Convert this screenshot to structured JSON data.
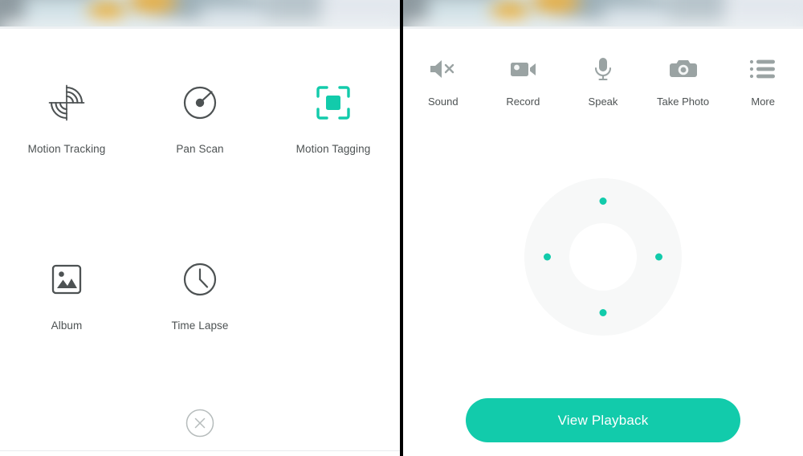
{
  "colors": {
    "accent": "#12cbab",
    "icon_dark": "#4d5253",
    "icon_gray": "#9aa3a3",
    "label": "#4d5253",
    "ring": "#f7f8f8",
    "divider": "#000000",
    "close_outline": "#b6bcbc"
  },
  "left_panel": {
    "name": "feature-menu",
    "rows": [
      [
        {
          "icon": "motion-tracking-icon",
          "label": "Motion Tracking",
          "active": false
        },
        {
          "icon": "pan-scan-icon",
          "label": "Pan Scan",
          "active": false
        },
        {
          "icon": "motion-tagging-icon",
          "label": "Motion Tagging",
          "active": true
        }
      ],
      [
        {
          "icon": "album-icon",
          "label": "Album",
          "active": false
        },
        {
          "icon": "time-lapse-icon",
          "label": "Time Lapse",
          "active": false
        }
      ]
    ],
    "close_button": {
      "icon": "close-circle-icon",
      "label": "Close"
    }
  },
  "right_panel": {
    "name": "live-controls",
    "toolbar": [
      {
        "icon": "sound-muted-icon",
        "label": "Sound"
      },
      {
        "icon": "record-video-icon",
        "label": "Record"
      },
      {
        "icon": "microphone-icon",
        "label": "Speak"
      },
      {
        "icon": "camera-icon",
        "label": "Take Photo"
      },
      {
        "icon": "list-more-icon",
        "label": "More"
      }
    ],
    "dpad": {
      "name": "direction-pad",
      "directions": [
        "up",
        "right",
        "down",
        "left"
      ]
    },
    "playback_button": {
      "label": "View Playback"
    }
  }
}
